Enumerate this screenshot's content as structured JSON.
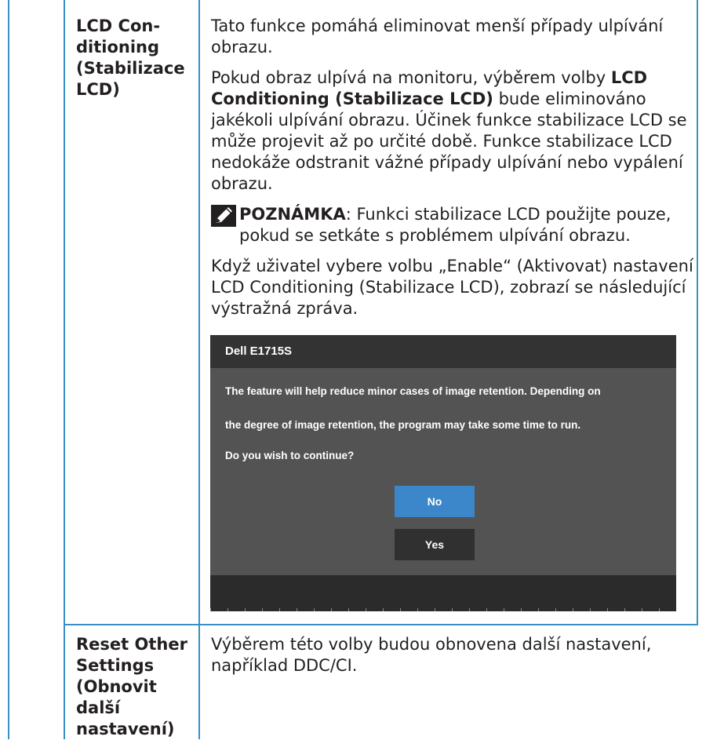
{
  "rows": [
    {
      "label": "LCD Con-\nditioning\n(Stabilizace\nLCD)",
      "description": {
        "p1": "Tato funkce pomáhá eliminovat menší případy ulpívání obrazu.",
        "p2_before": "Pokud obraz ulpívá na monitoru, výběrem volby ",
        "p2_bold": "LCD Conditioning (Stabilizace LCD)",
        "p2_after": " bude eliminováno jakékoli ulpívání obrazu. Účinek funkce stabilizace LCD se může projevit až po určité době. Funkce stabilizace LCD nedokáže odstranit vážné případy ulpívání nebo vypálení obrazu.",
        "note_label": "POZNÁMKA",
        "note_text": ": Funkci stabilizace LCD použijte pouze, pokud se setkáte s problémem ulpívání obrazu.",
        "p3": "Když uživatel vybere volbu „Enable“ (Aktivovat) nastavení LCD Conditioning (Stabilizace LCD), zobrazí se následující výstražná zpráva."
      },
      "dialog": {
        "title": "Dell E1715S",
        "line1": "The feature will help reduce minor cases of image retention. Depending on",
        "line2": "the degree of image retention, the program may take some time to run.",
        "line3": "Do you wish to continue?",
        "no_label": "No",
        "yes_label": "Yes"
      }
    },
    {
      "label": "Reset Other\nSettings\n(Obnovit\ndalší\nnastavení)",
      "description": {
        "p1": "Výběrem této volby budou obnovena další nastavení, například DDC/CI."
      }
    }
  ],
  "colors": {
    "border": "#3a8fc7",
    "osd_bg": "#535353",
    "osd_header": "#333333",
    "button_no": "#3b87c9",
    "button_yes": "#303030"
  },
  "icons": {
    "note": "pencil-note-icon"
  }
}
